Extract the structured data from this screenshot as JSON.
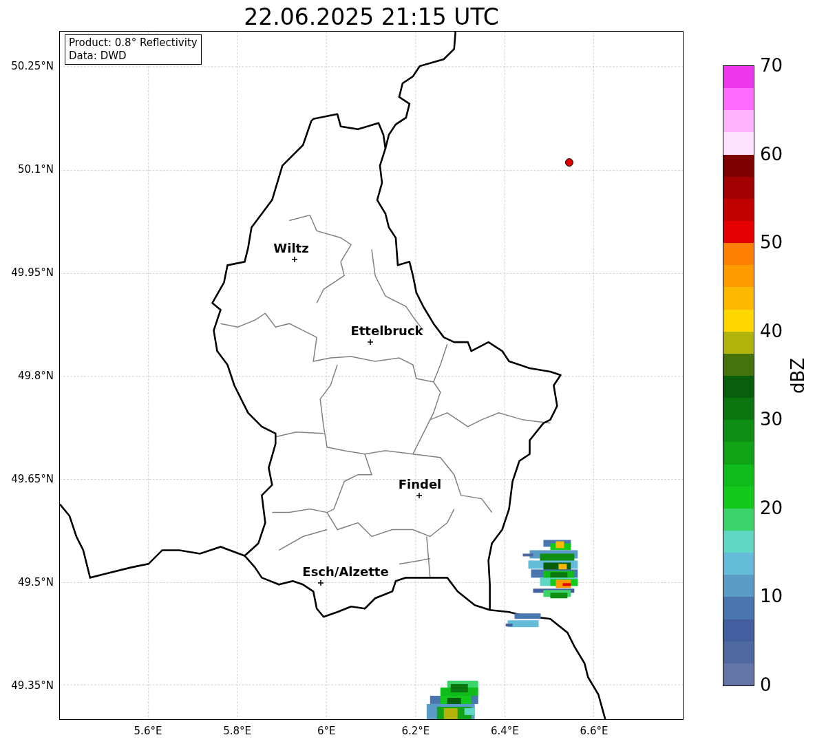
{
  "title": "22.06.2025 21:15 UTC",
  "legend": [
    "Product: 0.8° Reflectivity",
    "Data: DWD"
  ],
  "x_axis_labels": [
    "5.6°E",
    "5.8°E",
    "6°E",
    "6.2°E",
    "6.4°E",
    "6.6°E"
  ],
  "y_axis_labels": [
    "50.25°N",
    "50.1°N",
    "49.95°N",
    "49.8°N",
    "49.65°N",
    "49.5°N",
    "49.35°N"
  ],
  "cities": [
    {
      "name": "Wiltz"
    },
    {
      "name": "Ettelbruck"
    },
    {
      "name": "Findel"
    },
    {
      "name": "Esch/Alzette"
    }
  ],
  "colorbar": {
    "label": "dBZ",
    "ticks": [
      "70",
      "60",
      "50",
      "40",
      "30",
      "20",
      "10",
      "0"
    ],
    "segments": [
      {
        "color": "#6375a6"
      },
      {
        "color": "#5068a0"
      },
      {
        "color": "#445f9f"
      },
      {
        "color": "#4a76b0"
      },
      {
        "color": "#5b9cc6"
      },
      {
        "color": "#64bcd9"
      },
      {
        "color": "#60d6c4"
      },
      {
        "color": "#3cd46a"
      },
      {
        "color": "#12c91c"
      },
      {
        "color": "#10bb1c"
      },
      {
        "color": "#0fa315"
      },
      {
        "color": "#0e8e12"
      },
      {
        "color": "#0b7510"
      },
      {
        "color": "#085e0b"
      },
      {
        "color": "#44730c"
      },
      {
        "color": "#b1b30a"
      },
      {
        "color": "#ffd700"
      },
      {
        "color": "#fdb800"
      },
      {
        "color": "#fc9a00"
      },
      {
        "color": "#fe8000"
      },
      {
        "color": "#e40000"
      },
      {
        "color": "#c10000"
      },
      {
        "color": "#a00000"
      },
      {
        "color": "#7e0000"
      },
      {
        "color": "#ffe2ff"
      },
      {
        "color": "#ffb4ff"
      },
      {
        "color": "#ff6dff"
      },
      {
        "color": "#ec37ec"
      }
    ]
  }
}
